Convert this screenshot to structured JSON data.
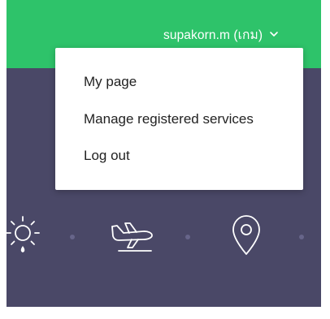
{
  "header": {
    "user_label": "supakorn.m (เกม)",
    "chevron_icon": "chevron-down-icon"
  },
  "dropdown": {
    "items": [
      {
        "label": "My page"
      },
      {
        "label": "Manage registered services"
      },
      {
        "label": "Log out"
      }
    ]
  },
  "hero": {
    "icons": [
      "weather-sun-rain-icon",
      "airplane-departure-icon",
      "location-pin-icon"
    ]
  },
  "colors": {
    "topbar": "#2ec36a",
    "hero_background": "#4a4867",
    "icon_stroke": "#ffffff",
    "dot": "#67658a"
  }
}
